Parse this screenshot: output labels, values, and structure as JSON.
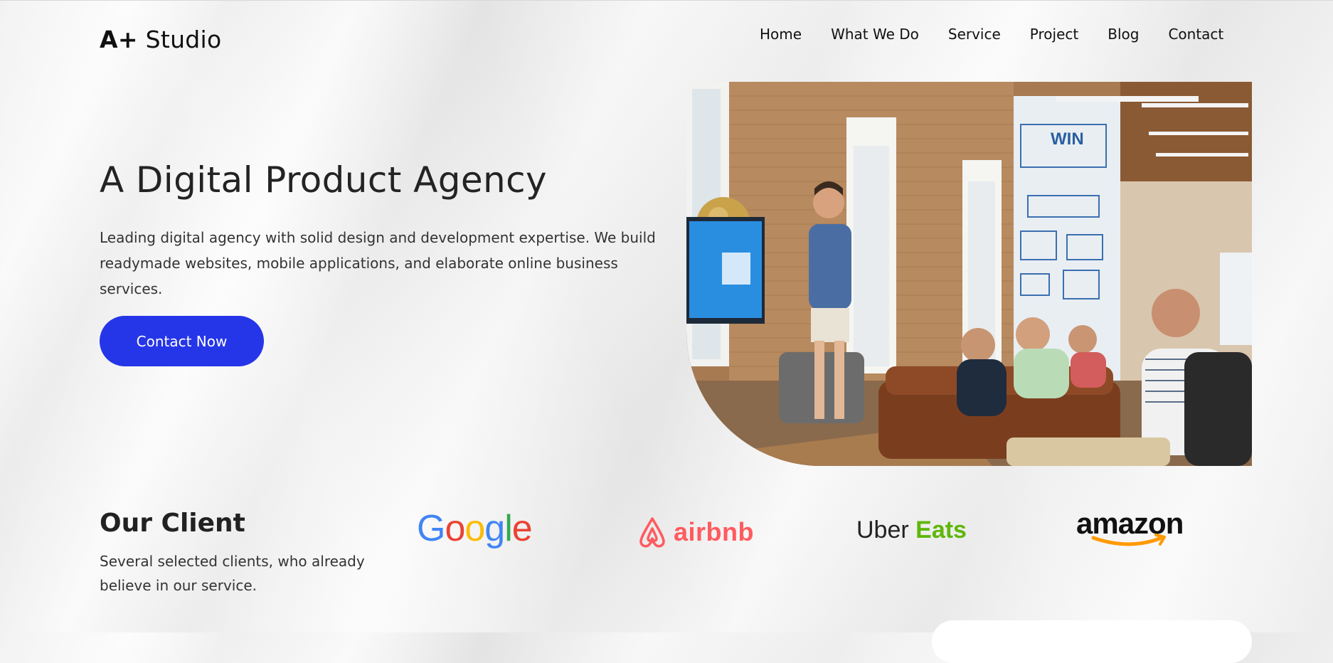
{
  "brand": {
    "logo_mark": "A+",
    "logo_text": "Studio"
  },
  "nav": {
    "items": [
      "Home",
      "What We Do",
      "Service",
      "Project",
      "Blog",
      "Contact"
    ]
  },
  "hero": {
    "title": "A Digital Product Agency",
    "description": "Leading digital agency with solid design and development expertise. We build readymade websites, mobile applications, and elaborate online business services.",
    "cta_label": "Contact Now",
    "cta_color": "#2535e8"
  },
  "clients": {
    "title": "Our Client",
    "description": "Several selected clients, who already believe in our service.",
    "logos": [
      "Google",
      "airbnb",
      "Uber Eats",
      "amazon"
    ],
    "colors": {
      "airbnb": "#ff5a5f",
      "uber_eats_green": "#5fb709",
      "amazon_arrow": "#ff9900"
    }
  }
}
